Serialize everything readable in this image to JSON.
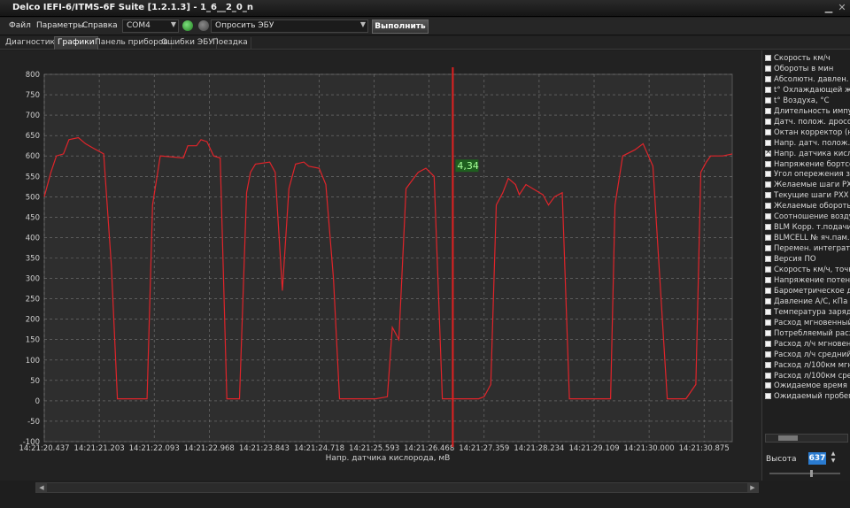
{
  "window": {
    "title": "Delco IEFI-6/ITMS-6F Suite [1.2.1.3] - 1_6__2_0_n"
  },
  "menu": {
    "items": [
      "Файл",
      "Параметры",
      "Справка"
    ]
  },
  "toolbar": {
    "port": "COM4",
    "query": "Опросить ЭБУ",
    "run_label": "Выполнить"
  },
  "tabs": [
    "Диагностика",
    "Графики",
    "Панель приборов",
    "Ошибки ЭБУ",
    "Поездка"
  ],
  "active_tab": 1,
  "side_panel": {
    "params": [
      {
        "label": "Скорость км/ч",
        "checked": false
      },
      {
        "label": "Обороты в мин",
        "checked": false
      },
      {
        "label": "Абсолютн. давлен. в",
        "checked": false
      },
      {
        "label": "t° Охлаждающей жид",
        "checked": false
      },
      {
        "label": "t° Воздуха, °С",
        "checked": false
      },
      {
        "label": "Длительность импу",
        "checked": false
      },
      {
        "label": "Датч. полож. дроссе",
        "checked": false
      },
      {
        "label": "Октан корректор (не",
        "checked": false
      },
      {
        "label": "Напр. датч. полож. д",
        "checked": false
      },
      {
        "label": "Напр. датчика кисло",
        "checked": true
      },
      {
        "label": "Напряжение бортсе",
        "checked": false
      },
      {
        "label": "Угол опережения за",
        "checked": false
      },
      {
        "label": "Желаемые шаги РХ",
        "checked": false
      },
      {
        "label": "Текущие шаги РХХ",
        "checked": false
      },
      {
        "label": "Желаемые обороть",
        "checked": false
      },
      {
        "label": "Соотношение возду",
        "checked": false
      },
      {
        "label": "BLM Корр. т.подачи",
        "checked": false
      },
      {
        "label": "BLMCELL № яч.пам.",
        "checked": false
      },
      {
        "label": "Перемен. интеграто",
        "checked": false
      },
      {
        "label": "Версия ПО",
        "checked": false
      },
      {
        "label": "Скорость км/ч, точн",
        "checked": false
      },
      {
        "label": "Напряжение потенц",
        "checked": false
      },
      {
        "label": "Барометрическое д",
        "checked": false
      },
      {
        "label": "Давление A/C, кПа",
        "checked": false
      },
      {
        "label": "Температура заряд",
        "checked": false
      },
      {
        "label": "Расход мгновенный",
        "checked": false
      },
      {
        "label": "Потребляемый расх",
        "checked": false
      },
      {
        "label": "Расход л/ч мгновен",
        "checked": false
      },
      {
        "label": "Расход л/ч средний",
        "checked": false
      },
      {
        "label": "Расход л/100км мгн",
        "checked": false
      },
      {
        "label": "Расход л/100км сре",
        "checked": false
      },
      {
        "label": "Ожидаемое время р",
        "checked": false
      },
      {
        "label": "Ожидаемый пробег",
        "checked": false
      }
    ],
    "height_label": "Высота",
    "height_value": "637"
  },
  "colors": {
    "series": "#e0242a",
    "cursor": "#e02020",
    "cursor_label_bg": "#1f5f1f",
    "cursor_label_fg": "#a8ff9a",
    "grid": "#8a8a8a"
  },
  "chart_data": {
    "type": "line",
    "xlabel": "Напр. датчика кислорода, мВ",
    "ylim": [
      -100,
      800
    ],
    "y_ticks": [
      -100,
      -50,
      0,
      50,
      100,
      150,
      200,
      250,
      300,
      350,
      400,
      450,
      500,
      550,
      600,
      650,
      700,
      750,
      800
    ],
    "x_ticks": [
      "14:21:20.437",
      "14:21:21.203",
      "14:21:22.093",
      "14:21:22.968",
      "14:21:23.843",
      "14:21:24.718",
      "14:21:25.593",
      "14:21:26.468",
      "14:21:27.359",
      "14:21:28.234",
      "14:21:29.109",
      "14:21:30.000",
      "14:21:30.875"
    ],
    "grid": true,
    "cursor": {
      "x": 7.43,
      "label": "4,34"
    },
    "series": [
      {
        "x": [
          0.0,
          0.12,
          0.22,
          0.35,
          0.45,
          0.62,
          0.75,
          0.88,
          1.08,
          1.22,
          1.33,
          1.43,
          1.62,
          1.77,
          1.87,
          1.97,
          2.11,
          2.53,
          2.61,
          2.77,
          2.85,
          2.96,
          3.08,
          3.2,
          3.32,
          3.44,
          3.55,
          3.68,
          3.75,
          3.84,
          4.1,
          4.2,
          4.33,
          4.45,
          4.57,
          4.72,
          4.81,
          5.0,
          5.12,
          5.26,
          5.37,
          5.53,
          5.67,
          5.82,
          6.03,
          6.24,
          6.33,
          6.45,
          6.58,
          6.69,
          6.8,
          6.94,
          7.09,
          7.16,
          7.24,
          7.3,
          7.67,
          7.8,
          7.9,
          8.0,
          8.12,
          8.22,
          8.34,
          8.44,
          8.57,
          8.64,
          8.76,
          9.07,
          9.17,
          9.28,
          9.42,
          9.55,
          9.88,
          10.0,
          10.07,
          10.16,
          10.3,
          10.38,
          10.52,
          10.74,
          10.89,
          11.07,
          11.33,
          11.45,
          11.67,
          11.85,
          11.94,
          12.04,
          12.12,
          12.34,
          12.52
        ],
        "y": [
          500,
          560,
          600,
          605,
          640,
          645,
          630,
          620,
          605,
          330,
          5,
          5,
          5,
          5,
          5,
          480,
          600,
          595,
          625,
          625,
          640,
          635,
          600,
          595,
          5,
          5,
          5,
          510,
          560,
          580,
          585,
          560,
          270,
          520,
          580,
          585,
          575,
          570,
          530,
          300,
          5,
          5,
          5,
          5,
          5,
          10,
          180,
          150,
          520,
          540,
          560,
          570,
          550,
          300,
          5,
          5,
          5,
          5,
          5,
          10,
          40,
          480,
          510,
          545,
          530,
          505,
          530,
          505,
          480,
          500,
          510,
          5,
          5,
          5,
          5,
          5,
          5,
          480,
          600,
          615,
          630,
          575,
          5,
          5,
          5,
          40,
          560,
          585,
          600,
          600,
          605
        ]
      }
    ]
  }
}
